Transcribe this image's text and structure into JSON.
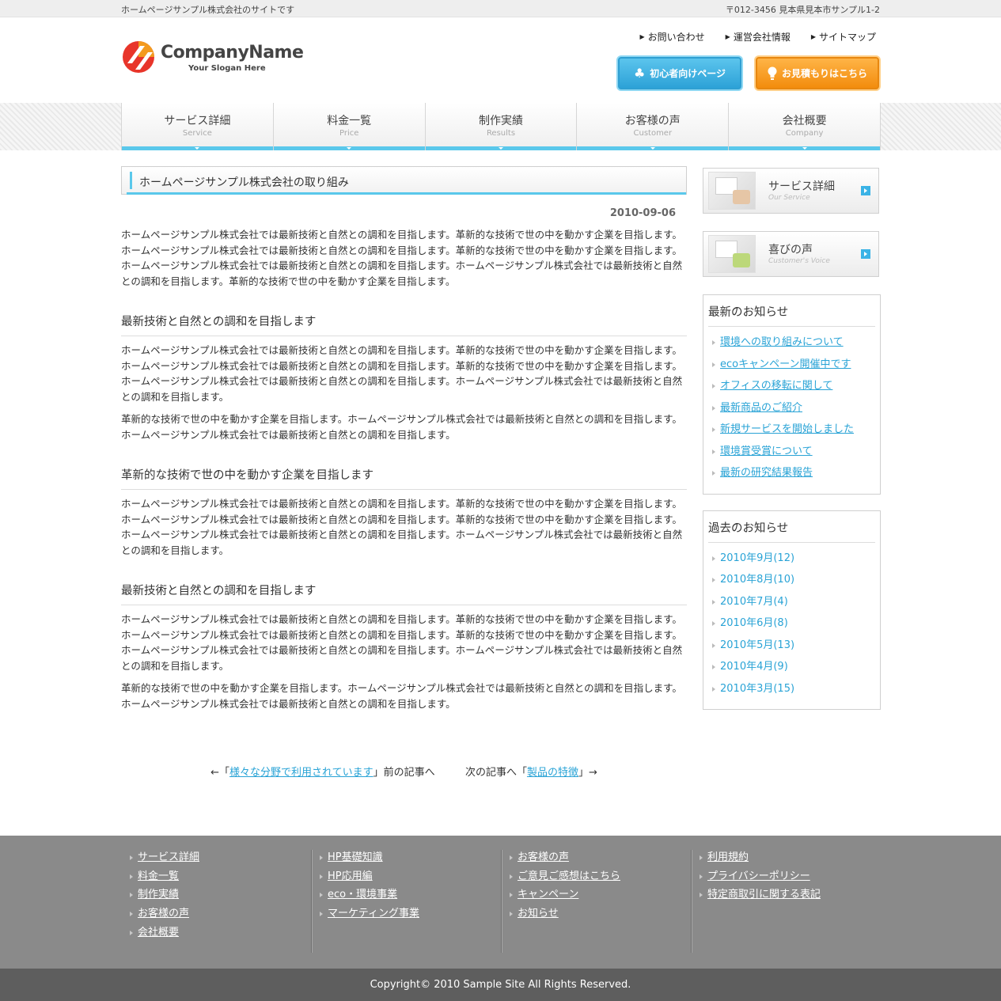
{
  "topbar": {
    "tagline": "ホームページサンプル株式会社のサイトです",
    "address": "〒012-3456 見本県見本市サンプル1-2"
  },
  "header": {
    "company_name": "CompanyName",
    "slogan": "Your Slogan Here",
    "util_links": [
      "お問い合わせ",
      "運営会社情報",
      "サイトマップ"
    ],
    "beginner_button": "初心者向けページ",
    "estimate_button": "お見積もりはこちら"
  },
  "nav": [
    {
      "jp": "サービス詳細",
      "en": "Service"
    },
    {
      "jp": "料金一覧",
      "en": "Price"
    },
    {
      "jp": "制作実績",
      "en": "Results"
    },
    {
      "jp": "お客様の声",
      "en": "Customer"
    },
    {
      "jp": "会社概要",
      "en": "Company"
    }
  ],
  "main": {
    "title": "ホームページサンプル株式会社の取り組み",
    "date": "2010-09-06",
    "intro": "ホームページサンプル株式会社では最新技術と自然との調和を目指します。革新的な技術で世の中を動かす企業を目指します。ホームページサンプル株式会社では最新技術と自然との調和を目指します。革新的な技術で世の中を動かす企業を目指します。ホームページサンプル株式会社では最新技術と自然との調和を目指します。ホームページサンプル株式会社では最新技術と自然との調和を目指します。革新的な技術で世の中を動かす企業を目指します。",
    "sections": [
      {
        "heading": "最新技術と自然との調和を目指します",
        "p1": "ホームページサンプル株式会社では最新技術と自然との調和を目指します。革新的な技術で世の中を動かす企業を目指します。ホームページサンプル株式会社では最新技術と自然との調和を目指します。革新的な技術で世の中を動かす企業を目指します。ホームページサンプル株式会社では最新技術と自然との調和を目指します。ホームページサンプル株式会社では最新技術と自然との調和を目指します。",
        "p2": "革新的な技術で世の中を動かす企業を目指します。ホームページサンプル株式会社では最新技術と自然との調和を目指します。ホームページサンプル株式会社では最新技術と自然との調和を目指します。"
      },
      {
        "heading": "革新的な技術で世の中を動かす企業を目指します",
        "p1": "ホームページサンプル株式会社では最新技術と自然との調和を目指します。革新的な技術で世の中を動かす企業を目指します。ホームページサンプル株式会社では最新技術と自然との調和を目指します。革新的な技術で世の中を動かす企業を目指します。ホームページサンプル株式会社では最新技術と自然との調和を目指します。ホームページサンプル株式会社では最新技術と自然との調和を目指します。"
      },
      {
        "heading": "最新技術と自然との調和を目指します",
        "p1": "ホームページサンプル株式会社では最新技術と自然との調和を目指します。革新的な技術で世の中を動かす企業を目指します。ホームページサンプル株式会社では最新技術と自然との調和を目指します。革新的な技術で世の中を動かす企業を目指します。ホームページサンプル株式会社では最新技術と自然との調和を目指します。ホームページサンプル株式会社では最新技術と自然との調和を目指します。",
        "p2": "革新的な技術で世の中を動かす企業を目指します。ホームページサンプル株式会社では最新技術と自然との調和を目指します。ホームページサンプル株式会社では最新技術と自然との調和を目指します。"
      }
    ],
    "pager": {
      "prev_prefix": "←「",
      "prev_link": "様々な分野で利用されています",
      "prev_suffix": "」前の記事へ",
      "next_prefix": "次の記事へ「",
      "next_link": "製品の特徴",
      "next_suffix": "」→"
    }
  },
  "sidebar": {
    "banners": [
      {
        "title": "サービス詳細",
        "sub": "Our Service"
      },
      {
        "title": "喜びの声",
        "sub": "Customer's Voice"
      }
    ],
    "news": {
      "heading": "最新のお知らせ",
      "items": [
        "環境への取り組みについて",
        "ecoキャンペーン開催中です",
        "オフィスの移転に関して",
        "最新商品のご紹介",
        "新規サービスを開始しました",
        "環境賞受賞について",
        "最新の研究結果報告"
      ]
    },
    "archive": {
      "heading": "過去のお知らせ",
      "items": [
        "2010年9月(12)",
        "2010年8月(10)",
        "2010年7月(4)",
        "2010年6月(8)",
        "2010年5月(13)",
        "2010年4月(9)",
        "2010年3月(15)"
      ]
    }
  },
  "footer": {
    "columns": [
      [
        "サービス詳細",
        "料金一覧",
        "制作実績",
        "お客様の声",
        "会社概要"
      ],
      [
        "HP基礎知識",
        "HP応用編",
        "eco・環境事業",
        "マーケティング事業"
      ],
      [
        "お客様の声",
        "ご意見ご感想はこちら",
        "キャンペーン",
        "お知らせ"
      ],
      [
        "利用規約",
        "プライバシーポリシー",
        "特定商取引に関する表記"
      ]
    ],
    "copyright": "Copyright© 2010 Sample Site All Rights Reserved."
  },
  "colors": {
    "accent": "#5ac8eb",
    "link": "#29a3d6",
    "beginner_button": "#2aa0d6",
    "estimate_button": "#f28a0a",
    "footer_bg": "#8a8a8a",
    "copyright_bg": "#5e5e5e"
  }
}
